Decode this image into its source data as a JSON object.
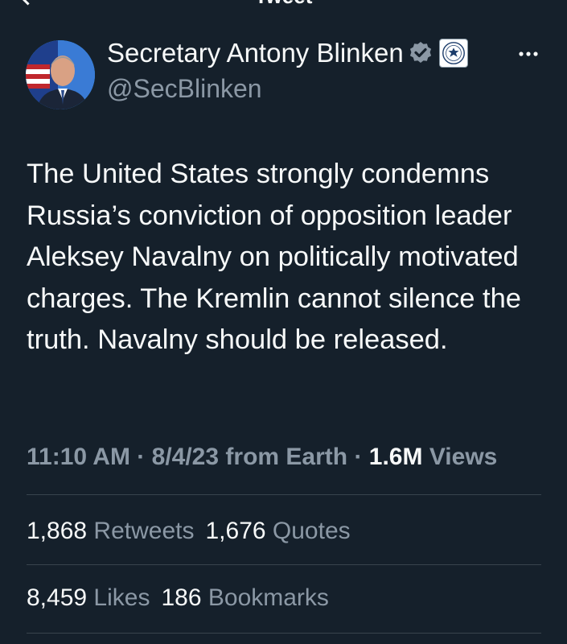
{
  "header": {
    "title": "Tweet"
  },
  "author": {
    "display_name": "Secretary Antony Blinken",
    "handle": "@SecBlinken",
    "icons": {
      "verified": "verified-badge-icon",
      "affiliation": "us-state-department-seal-icon",
      "more": "more-options-icon",
      "back": "back-arrow-icon"
    }
  },
  "tweet": {
    "text": "The United States strongly condemns Russia’s conviction of opposition leader Aleksey Navalny on politically motivated charges. The Kremlin cannot silence the truth. Navalny should be released."
  },
  "meta": {
    "time": "11:10 AM",
    "separator": "·",
    "date": "8/4/23",
    "source": "from Earth",
    "views_count": "1.6M",
    "views_label": "Views"
  },
  "stats": {
    "retweets_count": "1,868",
    "retweets_label": "Retweets",
    "quotes_count": "1,676",
    "quotes_label": "Quotes",
    "likes_count": "8,459",
    "likes_label": "Likes",
    "bookmarks_count": "186",
    "bookmarks_label": "Bookmarks"
  },
  "colors": {
    "background": "#15202b",
    "primary_text": "#f7f9f9",
    "secondary_text": "#8b98a5",
    "divider": "#38444d",
    "verified_badge": "#8b98a5"
  }
}
